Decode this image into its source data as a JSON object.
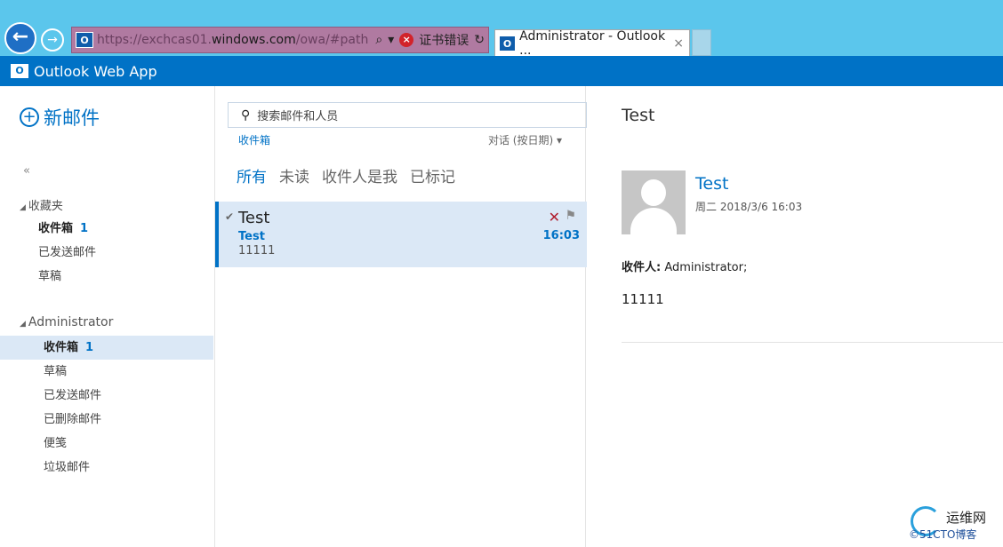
{
  "browser": {
    "url_prefix": "https://exchcas01.",
    "url_host": "windows.com",
    "url_path": "/owa/#path",
    "cert_error": "证书错误",
    "tab_title": "Administrator - Outlook ...",
    "tab_close": "×"
  },
  "app": {
    "title": "Outlook Web App"
  },
  "left": {
    "new_mail": "新邮件",
    "collapse": "«",
    "favorites_header": "收藏夹",
    "favorites": [
      {
        "label": "收件箱",
        "count": "1"
      },
      {
        "label": "已发送邮件"
      },
      {
        "label": "草稿"
      }
    ],
    "account_header": "Administrator",
    "folders": [
      {
        "label": "收件箱",
        "count": "1"
      },
      {
        "label": "草稿"
      },
      {
        "label": "已发送邮件"
      },
      {
        "label": "已删除邮件"
      },
      {
        "label": "便笺"
      },
      {
        "label": "垃圾邮件"
      }
    ]
  },
  "middle": {
    "search_placeholder": "搜索邮件和人员",
    "folder_label": "收件箱",
    "sort_label": "对话 (按日期) ▾",
    "filters": [
      "所有",
      "未读",
      "收件人是我",
      "已标记"
    ],
    "message": {
      "subject": "Test",
      "from": "Test",
      "preview": "11111",
      "time": "16:03"
    }
  },
  "reading": {
    "subject": "Test",
    "sender": "Test",
    "date": "周二 2018/3/6 16:03",
    "to_label": "收件人:",
    "to_value": "Administrator;",
    "body": "11111"
  },
  "watermark": {
    "line1": "运维网",
    "line2": "©51CTO博客"
  },
  "colors": {
    "accent": "#0072c6",
    "browser_chrome": "#5bc6ec",
    "selected_bg": "#dbe8f6"
  }
}
